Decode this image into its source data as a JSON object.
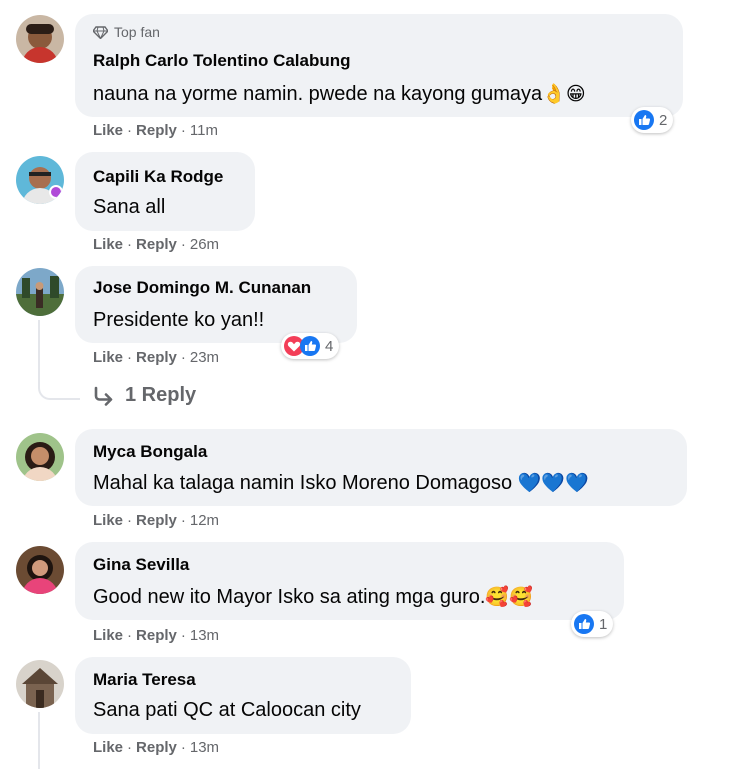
{
  "comments": [
    {
      "badge": "Top fan",
      "author": "Ralph Carlo Tolentino Calabung",
      "text": "nauna na yorme namin. pwede na kayong gumaya",
      "emoji": "👌😁",
      "like": "Like",
      "reply": "Reply",
      "time": "11m",
      "reaction_count": "2"
    },
    {
      "author": "Capili Ka Rodge",
      "text": "Sana all",
      "like": "Like",
      "reply": "Reply",
      "time": "26m"
    },
    {
      "author": "Jose Domingo M. Cunanan",
      "text": "Presidente ko yan!!",
      "like": "Like",
      "reply": "Reply",
      "time": "23m",
      "reaction_count": "4",
      "view_replies": "1 Reply"
    },
    {
      "author": "Myca Bongala",
      "text": "Mahal ka talaga namin Isko Moreno Domagoso",
      "emoji": "💙💙💙",
      "like": "Like",
      "reply": "Reply",
      "time": "12m"
    },
    {
      "author": "Gina Sevilla",
      "text": "Good new ito Mayor Isko sa ating mga guro.",
      "emoji": "🥰🥰",
      "like": "Like",
      "reply": "Reply",
      "time": "13m",
      "reaction_count": "1"
    },
    {
      "author": "Maria Teresa",
      "text": "Sana pati QC at Caloocan city",
      "like": "Like",
      "reply": "Reply",
      "time": "13m"
    }
  ],
  "colors": {
    "bubble": "#f0f2f5",
    "muted": "#65676b",
    "like_blue": "#1877f2",
    "love_red": "#f33e58"
  },
  "icons": [
    "diamond-icon",
    "like-reaction-icon",
    "love-reaction-icon",
    "reply-arrow-icon"
  ]
}
